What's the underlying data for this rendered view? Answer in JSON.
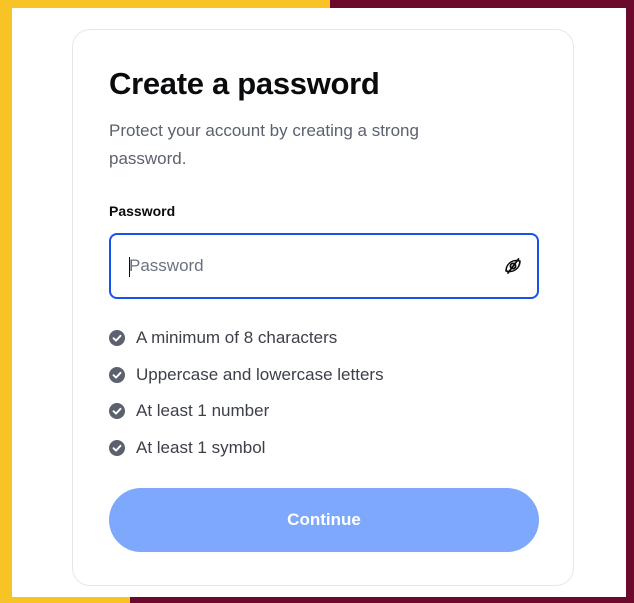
{
  "page": {
    "title": "Create a password",
    "subtitle": "Protect your account by creating a strong password."
  },
  "password_field": {
    "label": "Password",
    "placeholder": "Password",
    "value": "",
    "visibility_toggle_icon": "eye-slash-icon"
  },
  "requirements": [
    {
      "label": "A minimum of 8 characters",
      "icon": "check-circle-icon"
    },
    {
      "label": "Uppercase and lowercase letters",
      "icon": "check-circle-icon"
    },
    {
      "label": "At least 1 number",
      "icon": "check-circle-icon"
    },
    {
      "label": "At least 1 symbol",
      "icon": "check-circle-icon"
    }
  ],
  "continue_button": {
    "label": "Continue",
    "state": "disabled"
  },
  "colors": {
    "focus_border": "#1652f0",
    "button_disabled": "#7ea8fb",
    "check_icon": "#5b616e",
    "frame_yellow": "#f7c325",
    "frame_maroon": "#6b0a2d"
  }
}
